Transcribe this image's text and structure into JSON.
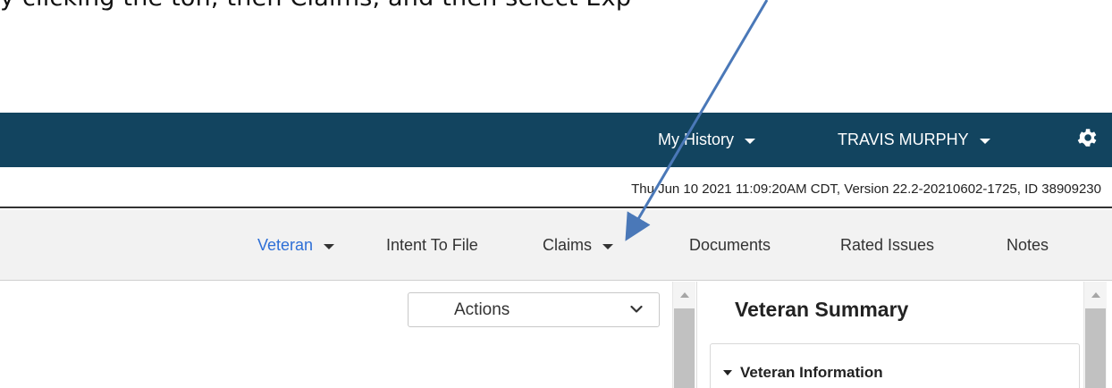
{
  "document": {
    "instruction": "y clicking the    ton, then Claims, and then select Exp"
  },
  "topbar": {
    "history_label": "My History",
    "user_label": "TRAVIS MURPHY",
    "settings_icon": "gear-icon",
    "background": "#12445f"
  },
  "status": {
    "text": "Thu Jun 10 2021 11:09:20AM CDT, Version 22.2-20210602-1725, ID 38909230"
  },
  "nav": {
    "items": [
      {
        "label": "Veteran",
        "dropdown": true,
        "active": true
      },
      {
        "label": "Intent To File",
        "dropdown": false,
        "active": false
      },
      {
        "label": "Claims",
        "dropdown": true,
        "active": false
      },
      {
        "label": "Documents",
        "dropdown": false,
        "active": false
      },
      {
        "label": "Rated Issues",
        "dropdown": false,
        "active": false
      },
      {
        "label": "Notes",
        "dropdown": false,
        "active": false
      }
    ],
    "active_color": "#2e6fd6"
  },
  "actions": {
    "selected": "Actions"
  },
  "summary": {
    "title": "Veteran Summary",
    "section": "Veteran Information"
  },
  "annotation": {
    "type": "arrow",
    "color": "#4a78b8"
  }
}
